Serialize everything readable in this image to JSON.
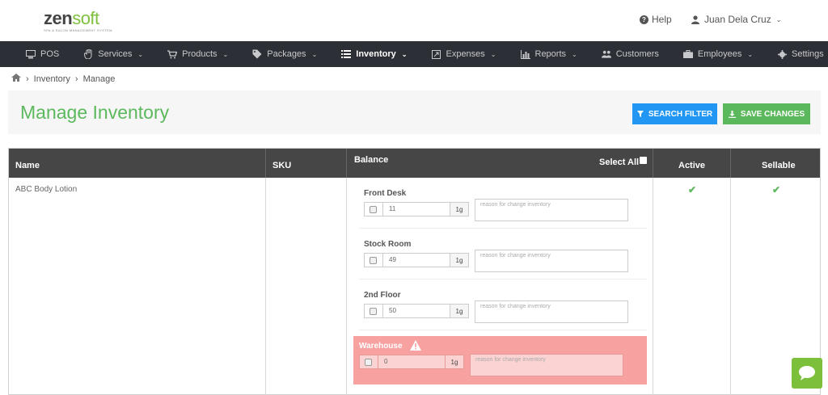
{
  "header": {
    "logo_main": "zen",
    "logo_accent": "soft",
    "logo_tagline": "SPA & SALON MANAGEMENT SYSTEM",
    "help_label": "Help",
    "user_name": "Juan Dela Cruz"
  },
  "nav": {
    "items": [
      {
        "label": "POS",
        "icon": "pos-icon"
      },
      {
        "label": "Services",
        "icon": "hand-icon"
      },
      {
        "label": "Products",
        "icon": "cart-icon"
      },
      {
        "label": "Packages",
        "icon": "tag-icon"
      },
      {
        "label": "Inventory",
        "icon": "list-icon",
        "active": true
      },
      {
        "label": "Expenses",
        "icon": "expenses-icon"
      },
      {
        "label": "Reports",
        "icon": "bar-chart-icon"
      },
      {
        "label": "Customers",
        "icon": "users-icon"
      },
      {
        "label": "Employees",
        "icon": "briefcase-icon"
      },
      {
        "label": "Settings",
        "icon": "gear-icon"
      }
    ]
  },
  "breadcrumb": {
    "items": [
      "Inventory",
      "Manage"
    ]
  },
  "page": {
    "title": "Manage Inventory",
    "search_filter_label": "SEARCH FILTER",
    "save_changes_label": "SAVE CHANGES"
  },
  "table": {
    "headers": {
      "name": "Name",
      "sku": "SKU",
      "balance": "Balance",
      "select_all": "Select All",
      "active": "Active",
      "sellable": "Sellable"
    },
    "row": {
      "name": "ABC Body Lotion",
      "sku": "",
      "locations": [
        {
          "label": "Front Desk",
          "qty": "11",
          "unit": "1g",
          "reason_placeholder": "reason for change inventory",
          "warning": false
        },
        {
          "label": "Stock Room",
          "qty": "49",
          "unit": "1g",
          "reason_placeholder": "reason for change inventory",
          "warning": false
        },
        {
          "label": "2nd Floor",
          "qty": "50",
          "unit": "1g",
          "reason_placeholder": "reason for change inventory",
          "warning": false
        },
        {
          "label": "Warehouse",
          "qty": "0",
          "unit": "1g",
          "reason_placeholder": "reason for change inventory",
          "warning": true
        }
      ]
    }
  },
  "colors": {
    "accent_green": "#5cb85c",
    "button_blue": "#2196f3",
    "nav_dark": "#2c2f36",
    "header_dark": "#464646",
    "warning_bg": "#f8a1a1"
  }
}
